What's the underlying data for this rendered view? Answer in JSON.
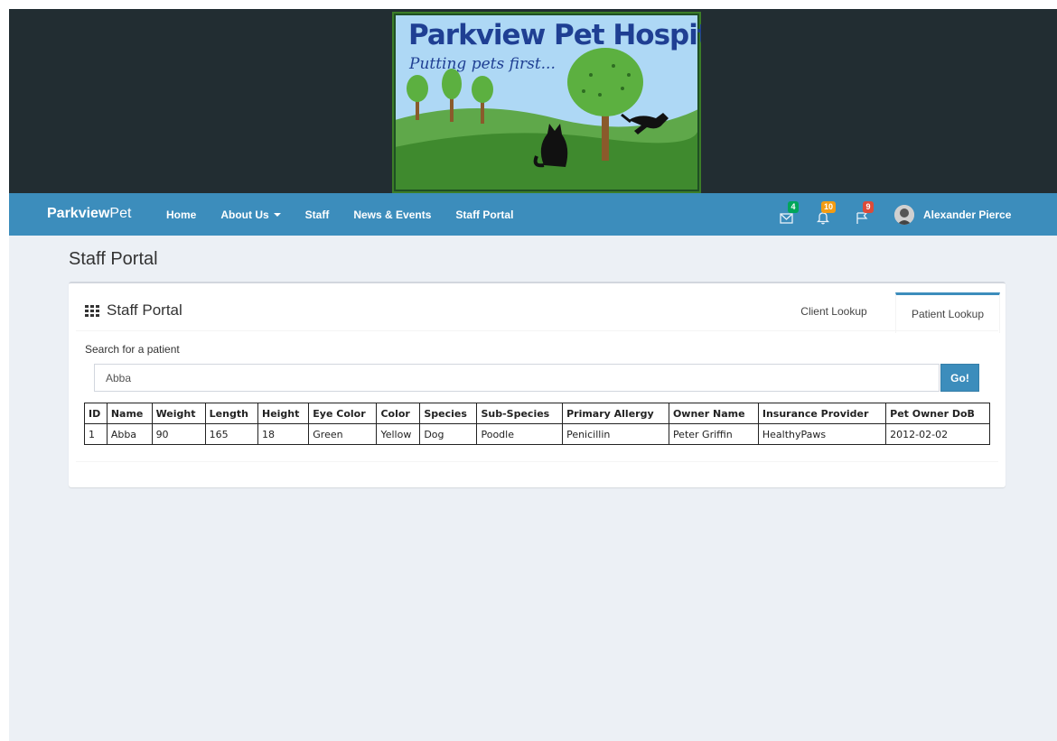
{
  "banner": {
    "title": "Parkview Pet Hospital",
    "tagline": "Putting pets first..."
  },
  "navbar": {
    "brand_bold": "Parkview",
    "brand_rest": "Pet",
    "links": [
      "Home",
      "About Us",
      "Staff",
      "News & Events",
      "Staff Portal"
    ],
    "messages_count": "4",
    "notifications_count": "10",
    "tasks_count": "9",
    "user_name": "Alexander Pierce"
  },
  "page": {
    "title": "Staff Portal"
  },
  "portal": {
    "box_title": "Staff Portal",
    "tabs": [
      "Client Lookup",
      "Patient Lookup"
    ],
    "active_tab": "Patient Lookup",
    "search_label": "Search for a patient",
    "search_value": "Abba",
    "go_label": "Go!",
    "table": {
      "headers": [
        "ID",
        "Name",
        "Weight",
        "Length",
        "Height",
        "Eye Color",
        "Color",
        "Species",
        "Sub-Species",
        "Primary Allergy",
        "Owner Name",
        "Insurance Provider",
        "Pet Owner DoB"
      ],
      "rows": [
        [
          "1",
          "Abba",
          "90",
          "165",
          "18",
          "Green",
          "Yellow",
          "Dog",
          "Poodle",
          "Penicillin",
          "Peter Griffin",
          "HealthyPaws",
          "2012-02-02"
        ]
      ]
    }
  },
  "colors": {
    "header_dark": "#222d32",
    "nav_blue": "#3c8dbc",
    "content_bg": "#ecf0f5",
    "badge_green": "#00a65a",
    "badge_yellow": "#f39c12",
    "badge_red": "#dd4b39"
  },
  "icons": {
    "messages": "envelope-icon",
    "notifications": "bell-icon",
    "tasks": "flag-icon",
    "box_title": "grid-icon"
  }
}
